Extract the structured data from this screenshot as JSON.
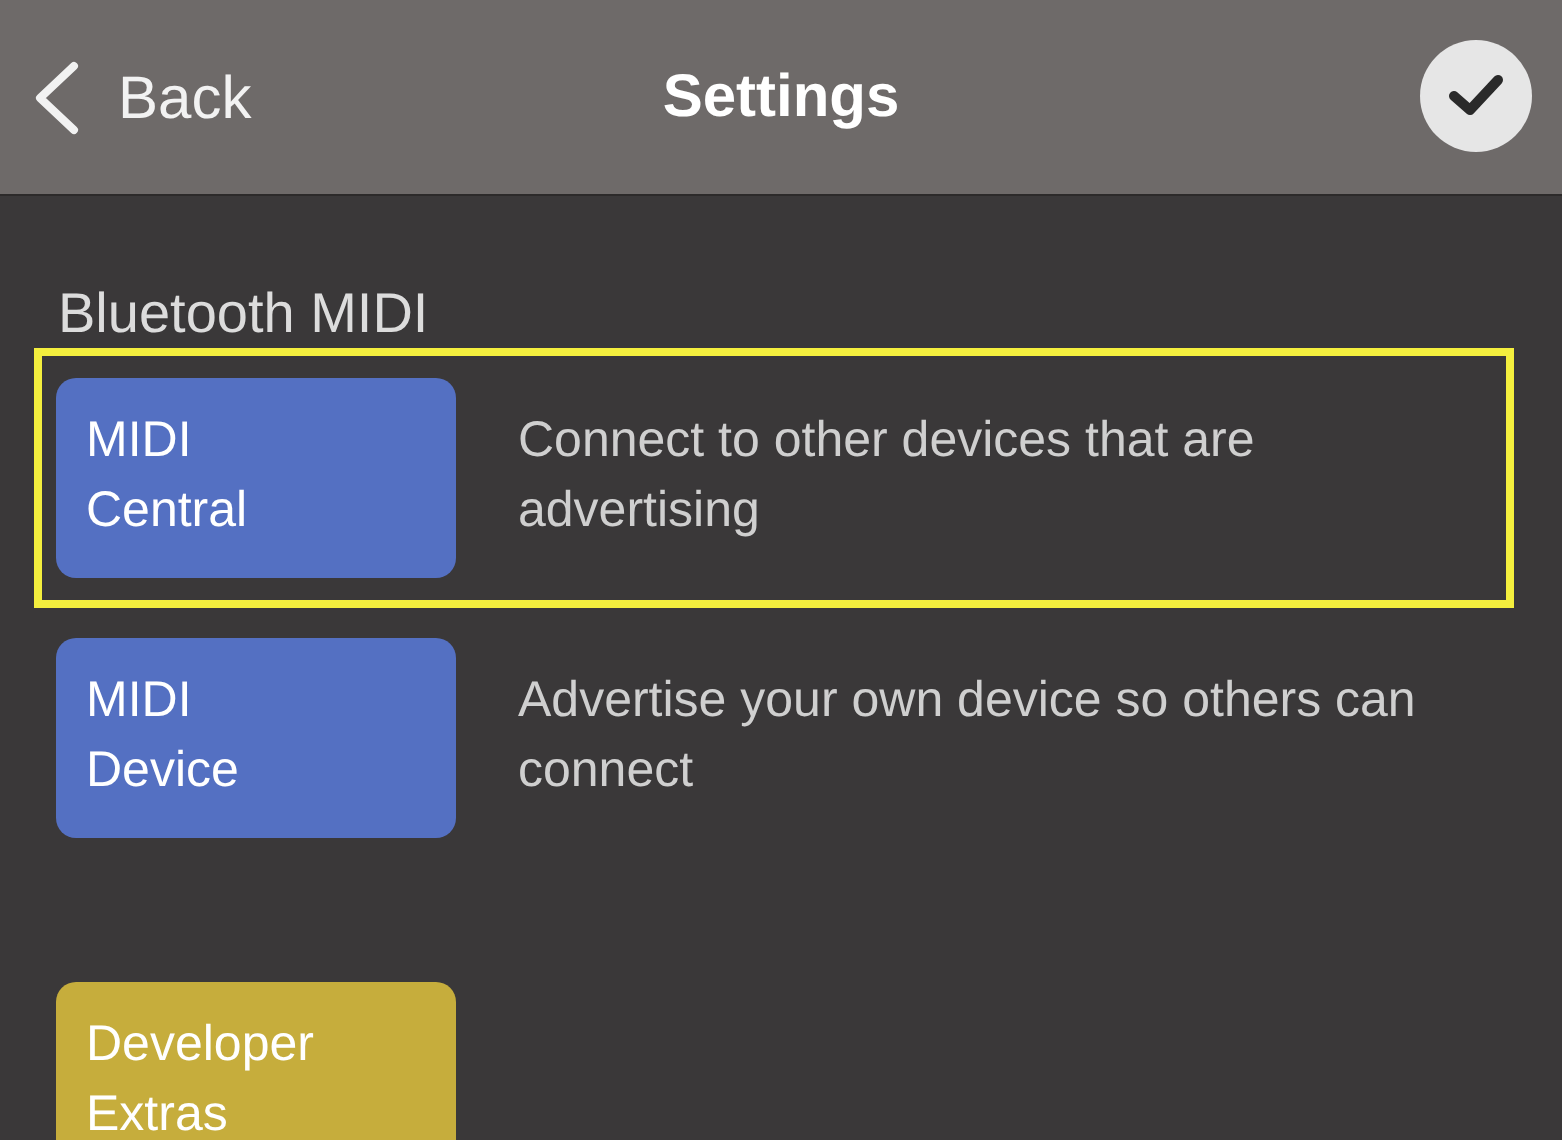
{
  "header": {
    "back_label": "Back",
    "title": "Settings"
  },
  "sections": [
    {
      "title": "Bluetooth MIDI",
      "items": [
        {
          "label": "MIDI Central",
          "description": "Connect to other devices that are advertising",
          "color": "#5470c2",
          "highlighted": true
        },
        {
          "label": "MIDI Device",
          "description": "Advertise your own device so others can connect",
          "color": "#5470c2",
          "highlighted": false
        }
      ]
    },
    {
      "items": [
        {
          "label": "Developer Extras",
          "color": "#c6ad3c",
          "highlighted": false
        }
      ]
    }
  ]
}
